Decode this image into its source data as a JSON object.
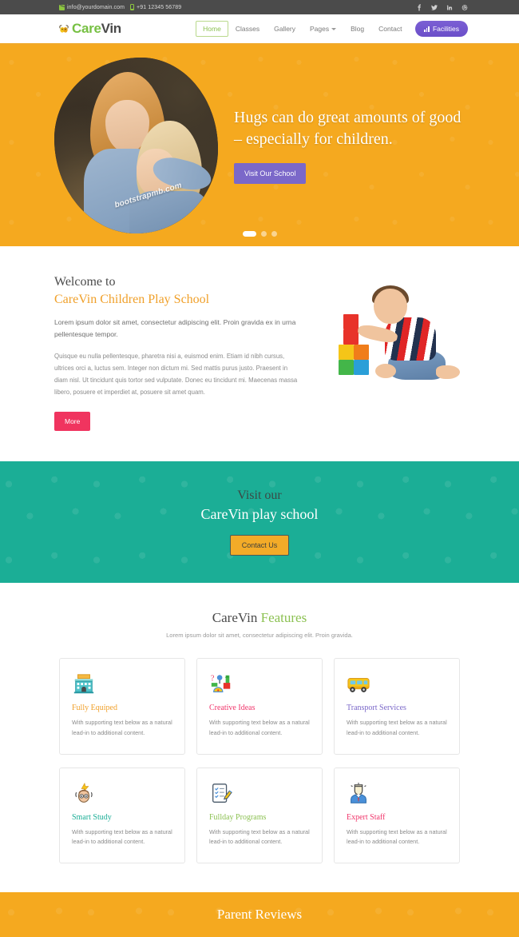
{
  "topbar": {
    "email": "info@yourdomain.com",
    "phone": "+91 12345 56789",
    "mail_icon": "mail-icon",
    "phone_icon": "phone-icon",
    "social": [
      {
        "name": "facebook-icon",
        "label": "f"
      },
      {
        "name": "twitter-icon",
        "label": "t"
      },
      {
        "name": "linkedin-icon",
        "label": "in"
      },
      {
        "name": "dribbble-icon",
        "label": "d"
      }
    ]
  },
  "header": {
    "logo_icon": "bee-logo-icon",
    "logo_first": "Care",
    "logo_second": "Vin",
    "nav": [
      {
        "label": "Home",
        "active": true
      },
      {
        "label": "Classes",
        "active": false
      },
      {
        "label": "Gallery",
        "active": false
      },
      {
        "label": "Pages",
        "active": false,
        "has_caret": true
      },
      {
        "label": "Blog",
        "active": false
      },
      {
        "label": "Contact",
        "active": false
      }
    ],
    "facilities_label": "Facilities"
  },
  "hero": {
    "title": "Hugs can do great amounts of good – especially for children.",
    "button_label": "Visit Our School",
    "watermark": "bootstrapmb.com",
    "dots": [
      {
        "active": true
      },
      {
        "active": false
      },
      {
        "active": false
      }
    ]
  },
  "welcome": {
    "heading_line1": "Welcome to",
    "heading_line2": "CareVin Children Play School",
    "lead": "Lorem ipsum dolor sit amet, consectetur adipiscing elit. Proin gravida ex in urna pellentesque tempor.",
    "body": "Quisque eu nulla pellentesque, pharetra nisi a, euismod enim. Etiam id nibh cursus, ultrices orci a, luctus sem. Integer non dictum mi. Sed mattis purus justo. Praesent in diam nisl. Ut tincidunt quis tortor sed vulputate. Donec eu tincidunt mi. Maecenas massa libero, posuere et imperdiet at, posuere sit amet quam.",
    "more_label": "More"
  },
  "cta": {
    "line1": "Visit our",
    "line2": "CareVin play school",
    "button_label": "Contact Us"
  },
  "features": {
    "title_dark": "CareVin ",
    "title_accent": "Features",
    "subtitle": "Lorem ipsum dolor sit amet, consectetur adipiscing elit. Proin gravida.",
    "cards": [
      {
        "title": "Fully Equiped",
        "desc": "With supporting text below as a natural lead-in to additional content.",
        "color": "#f0a02a",
        "icon": "school-building-icon"
      },
      {
        "title": "Creative Ideas",
        "desc": "With supporting text below as a natural lead-in to additional content.",
        "color": "#f0346a",
        "icon": "creative-tools-icon"
      },
      {
        "title": "Transport Services",
        "desc": "With supporting text below as a natural lead-in to additional content.",
        "color": "#7b68c9",
        "icon": "school-bus-icon"
      },
      {
        "title": "Smart Study",
        "desc": "With supporting text below as a natural lead-in to additional content.",
        "color": "#1bae96",
        "icon": "smart-kid-icon"
      },
      {
        "title": "Fullday Programs",
        "desc": "With supporting text below as a natural lead-in to additional content.",
        "color": "#8cc152",
        "icon": "checklist-icon"
      },
      {
        "title": "Expert Staff",
        "desc": "With supporting text below as a natural lead-in to additional content.",
        "color": "#f0346a",
        "icon": "staff-person-icon"
      }
    ]
  },
  "reviews": {
    "title": "Parent Reviews"
  },
  "colors": {
    "orange": "#f5a91f",
    "green": "#8cc152",
    "teal": "#1bae96",
    "purple": "#7b68c9",
    "pink": "#f0345f",
    "dark": "#4b4b4b"
  }
}
